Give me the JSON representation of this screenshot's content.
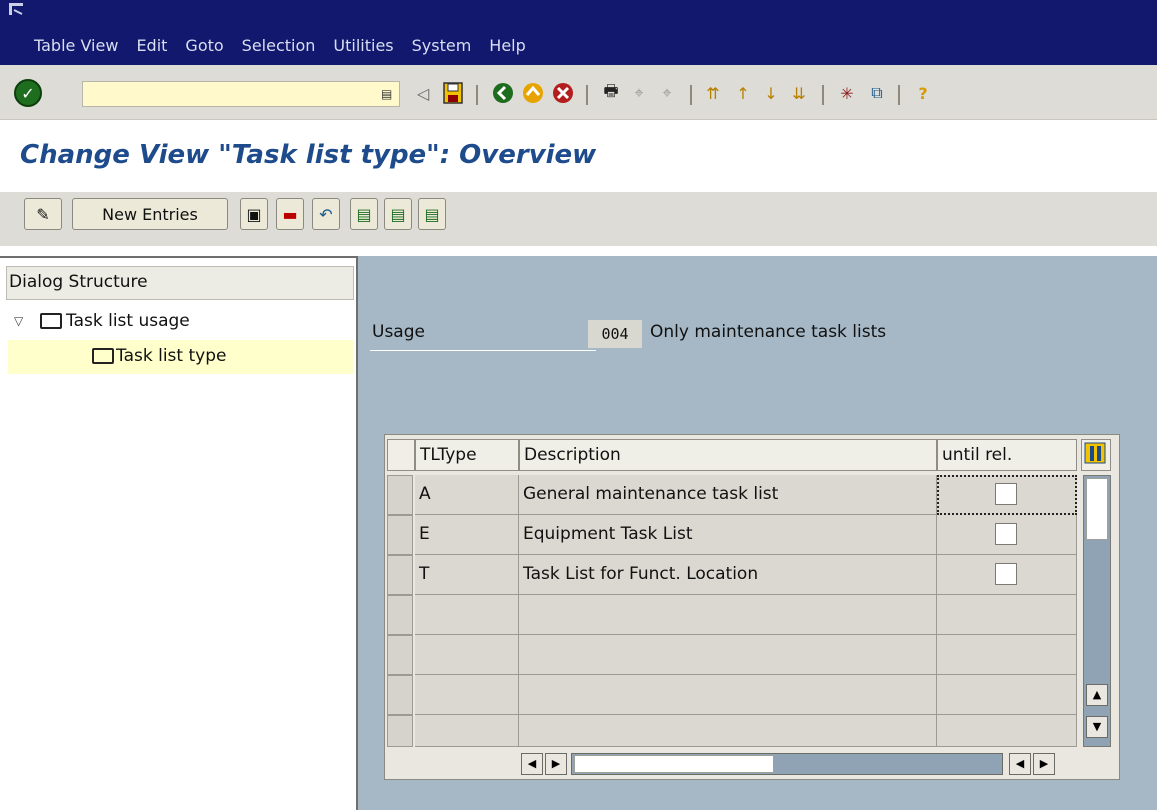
{
  "menu": {
    "items": [
      {
        "label": "Table View"
      },
      {
        "label": "Edit"
      },
      {
        "label": "Goto"
      },
      {
        "label": "Selection"
      },
      {
        "label": "Utilities"
      },
      {
        "label": "System"
      },
      {
        "label": "Help"
      }
    ]
  },
  "command_field": {
    "value": ""
  },
  "title": "Change View \"Task list type\": Overview",
  "app_toolbar": {
    "new_entries_label": "New Entries"
  },
  "dialog_structure": {
    "header": "Dialog Structure",
    "items": [
      {
        "label": "Task list usage"
      },
      {
        "label": "Task list type"
      }
    ]
  },
  "usage": {
    "label": "Usage",
    "code": "004",
    "text": "Only maintenance task lists"
  },
  "table": {
    "columns": [
      {
        "label": "TLType"
      },
      {
        "label": "Description"
      },
      {
        "label": "until rel."
      }
    ],
    "rows": [
      {
        "tltype": "A",
        "description": "General maintenance task list",
        "until_rel": false
      },
      {
        "tltype": "E",
        "description": "Equipment Task List",
        "until_rel": false
      },
      {
        "tltype": "T",
        "description": "Task List for Funct. Location",
        "until_rel": false
      }
    ]
  },
  "colors": {
    "menubar": "#11186e",
    "title": "#1e4b8c",
    "main_bg": "#a6b8c6",
    "highlight": "#ffffcc"
  }
}
